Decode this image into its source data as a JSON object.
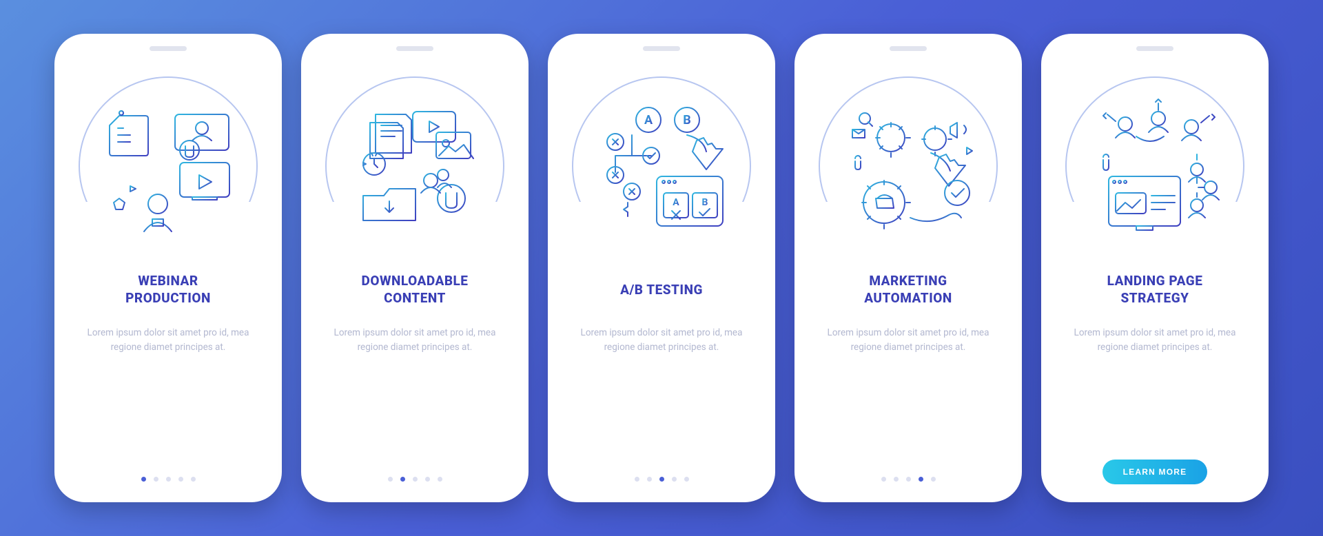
{
  "screens": [
    {
      "title": "WEBINAR\nPRODUCTION",
      "body": "Lorem ipsum dolor sit amet pro id, mea regione diamet principes at.",
      "cta": null
    },
    {
      "title": "DOWNLOADABLE\nCONTENT",
      "body": "Lorem ipsum dolor sit amet pro id, mea regione diamet principes at.",
      "cta": null
    },
    {
      "title": "A/B TESTING",
      "body": "Lorem ipsum dolor sit amet pro id, mea regione diamet principes at.",
      "cta": null
    },
    {
      "title": "MARKETING\nAUTOMATION",
      "body": "Lorem ipsum dolor sit amet pro id, mea regione diamet principes at.",
      "cta": null
    },
    {
      "title": "LANDING PAGE\nSTRATEGY",
      "body": "Lorem ipsum dolor sit amet pro id, mea regione diamet principes at.",
      "cta": "LEARN MORE"
    }
  ],
  "pagination_total": 5,
  "colors": {
    "grad_a": "#2fb6e0",
    "grad_b": "#3f3fc0"
  },
  "theme": "blue-gradient-onboarding"
}
